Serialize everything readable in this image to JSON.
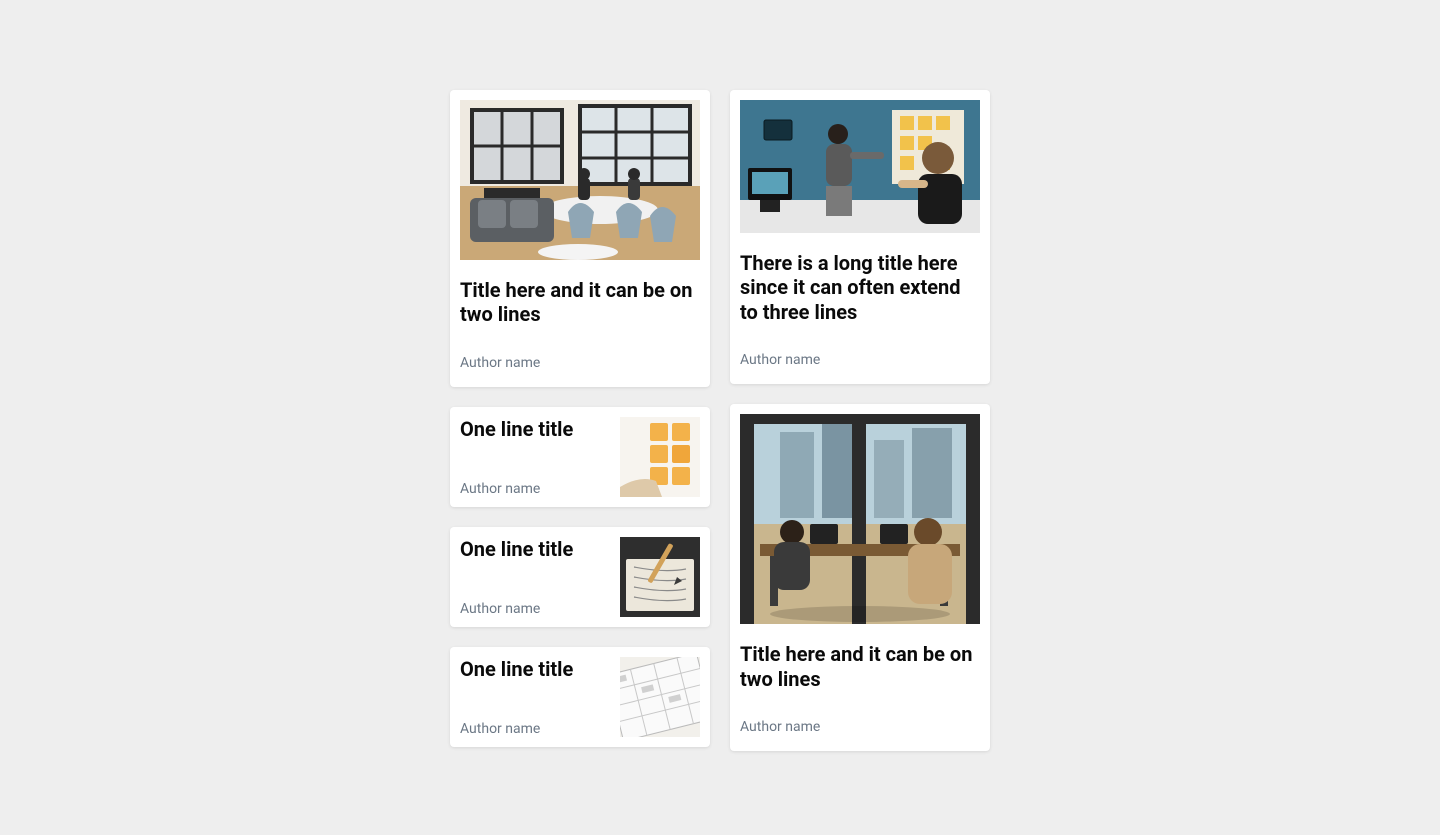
{
  "left": [
    {
      "title": "Title here and it can be on two lines",
      "author": "Author name",
      "layout": "large",
      "img": "loft"
    },
    {
      "title": "One line title",
      "author": "Author name",
      "layout": "row",
      "img": "sticky"
    },
    {
      "title": "One line title",
      "author": "Author name",
      "layout": "row",
      "img": "sketch"
    },
    {
      "title": "One line title",
      "author": "Author name",
      "layout": "row",
      "img": "wire"
    }
  ],
  "right": [
    {
      "title": "There is a long title here since it can often extend to three lines",
      "author": "Author name",
      "layout": "large",
      "img": "bluewall"
    },
    {
      "title": "Title here and it can be on two lines",
      "author": "Author name",
      "layout": "large",
      "img": "office"
    }
  ]
}
